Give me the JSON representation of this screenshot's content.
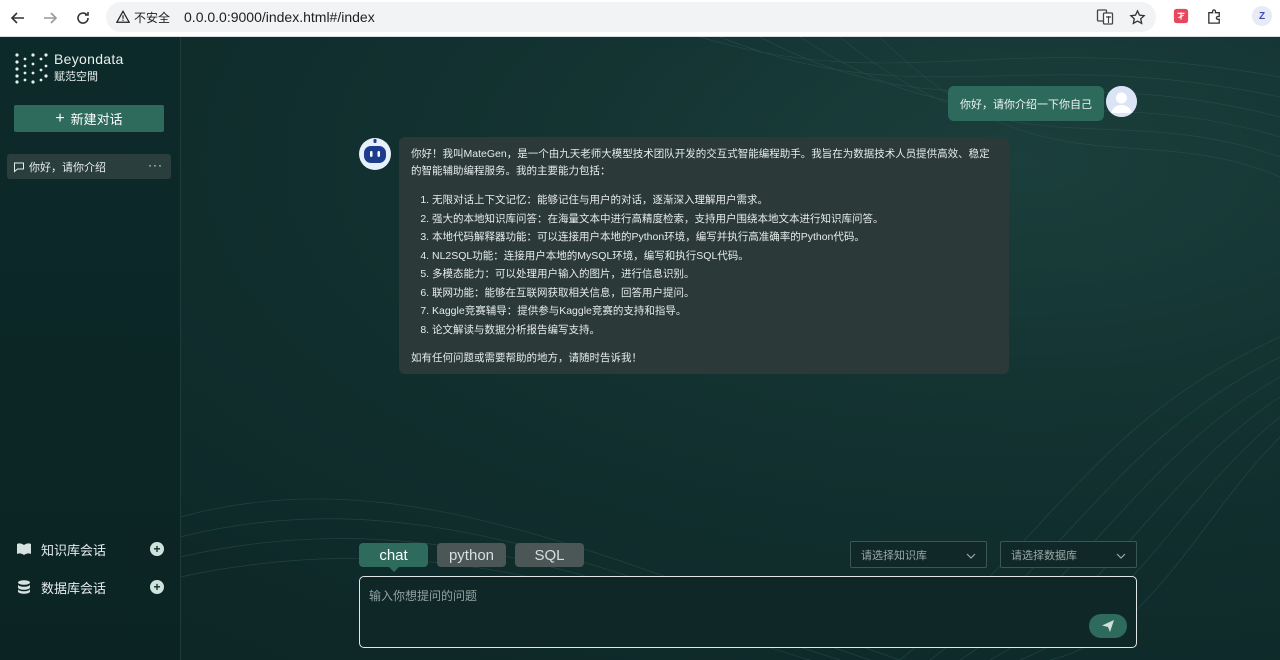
{
  "browser": {
    "security_label": "不安全",
    "url": "0.0.0.0:9000/index.html#/index",
    "profile_initial": "Z"
  },
  "sidebar": {
    "logo_en": "Beyondata",
    "logo_cn": "赋范空間",
    "new_chat_label": "新建对话",
    "conversations": [
      {
        "title": "你好，请你介绍"
      }
    ],
    "sections": [
      {
        "label": "知识库会话",
        "icon": "book-icon"
      },
      {
        "label": "数据库会话",
        "icon": "database-icon"
      }
    ]
  },
  "chat": {
    "user_message": "你好，请你介绍一下你自己",
    "bot_intro": "你好！我叫MateGen，是一个由九天老师大模型技术团队开发的交互式智能编程助手。我旨在为数据技术人员提供高效、稳定的智能辅助编程服务。我的主要能力包括：",
    "bot_list": [
      "无限对话上下文记忆：能够记住与用户的对话，逐渐深入理解用户需求。",
      "强大的本地知识库问答：在海量文本中进行高精度检索，支持用户围绕本地文本进行知识库问答。",
      "本地代码解释器功能：可以连接用户本地的Python环境，编写并执行高准确率的Python代码。",
      "NL2SQL功能：连接用户本地的MySQL环境，编写和执行SQL代码。",
      "多模态能力：可以处理用户输入的图片，进行信息识别。",
      "联网功能：能够在互联网获取相关信息，回答用户提问。",
      "Kaggle竞赛辅导：提供参与Kaggle竞赛的支持和指导。",
      "论文解读与数据分析报告编写支持。"
    ],
    "bot_outro": "如有任何问题或需要帮助的地方，请随时告诉我！"
  },
  "composer": {
    "modes": [
      {
        "label": "chat",
        "active": true
      },
      {
        "label": "python",
        "active": false
      },
      {
        "label": "SQL",
        "active": false
      }
    ],
    "knowledge_select_placeholder": "请选择知识库",
    "database_select_placeholder": "请选择数据库",
    "input_placeholder": "输入你想提问的问题"
  },
  "colors": {
    "accent": "#2f6b5c",
    "background": "#0f2a2a",
    "bubble": "#2b3938"
  }
}
